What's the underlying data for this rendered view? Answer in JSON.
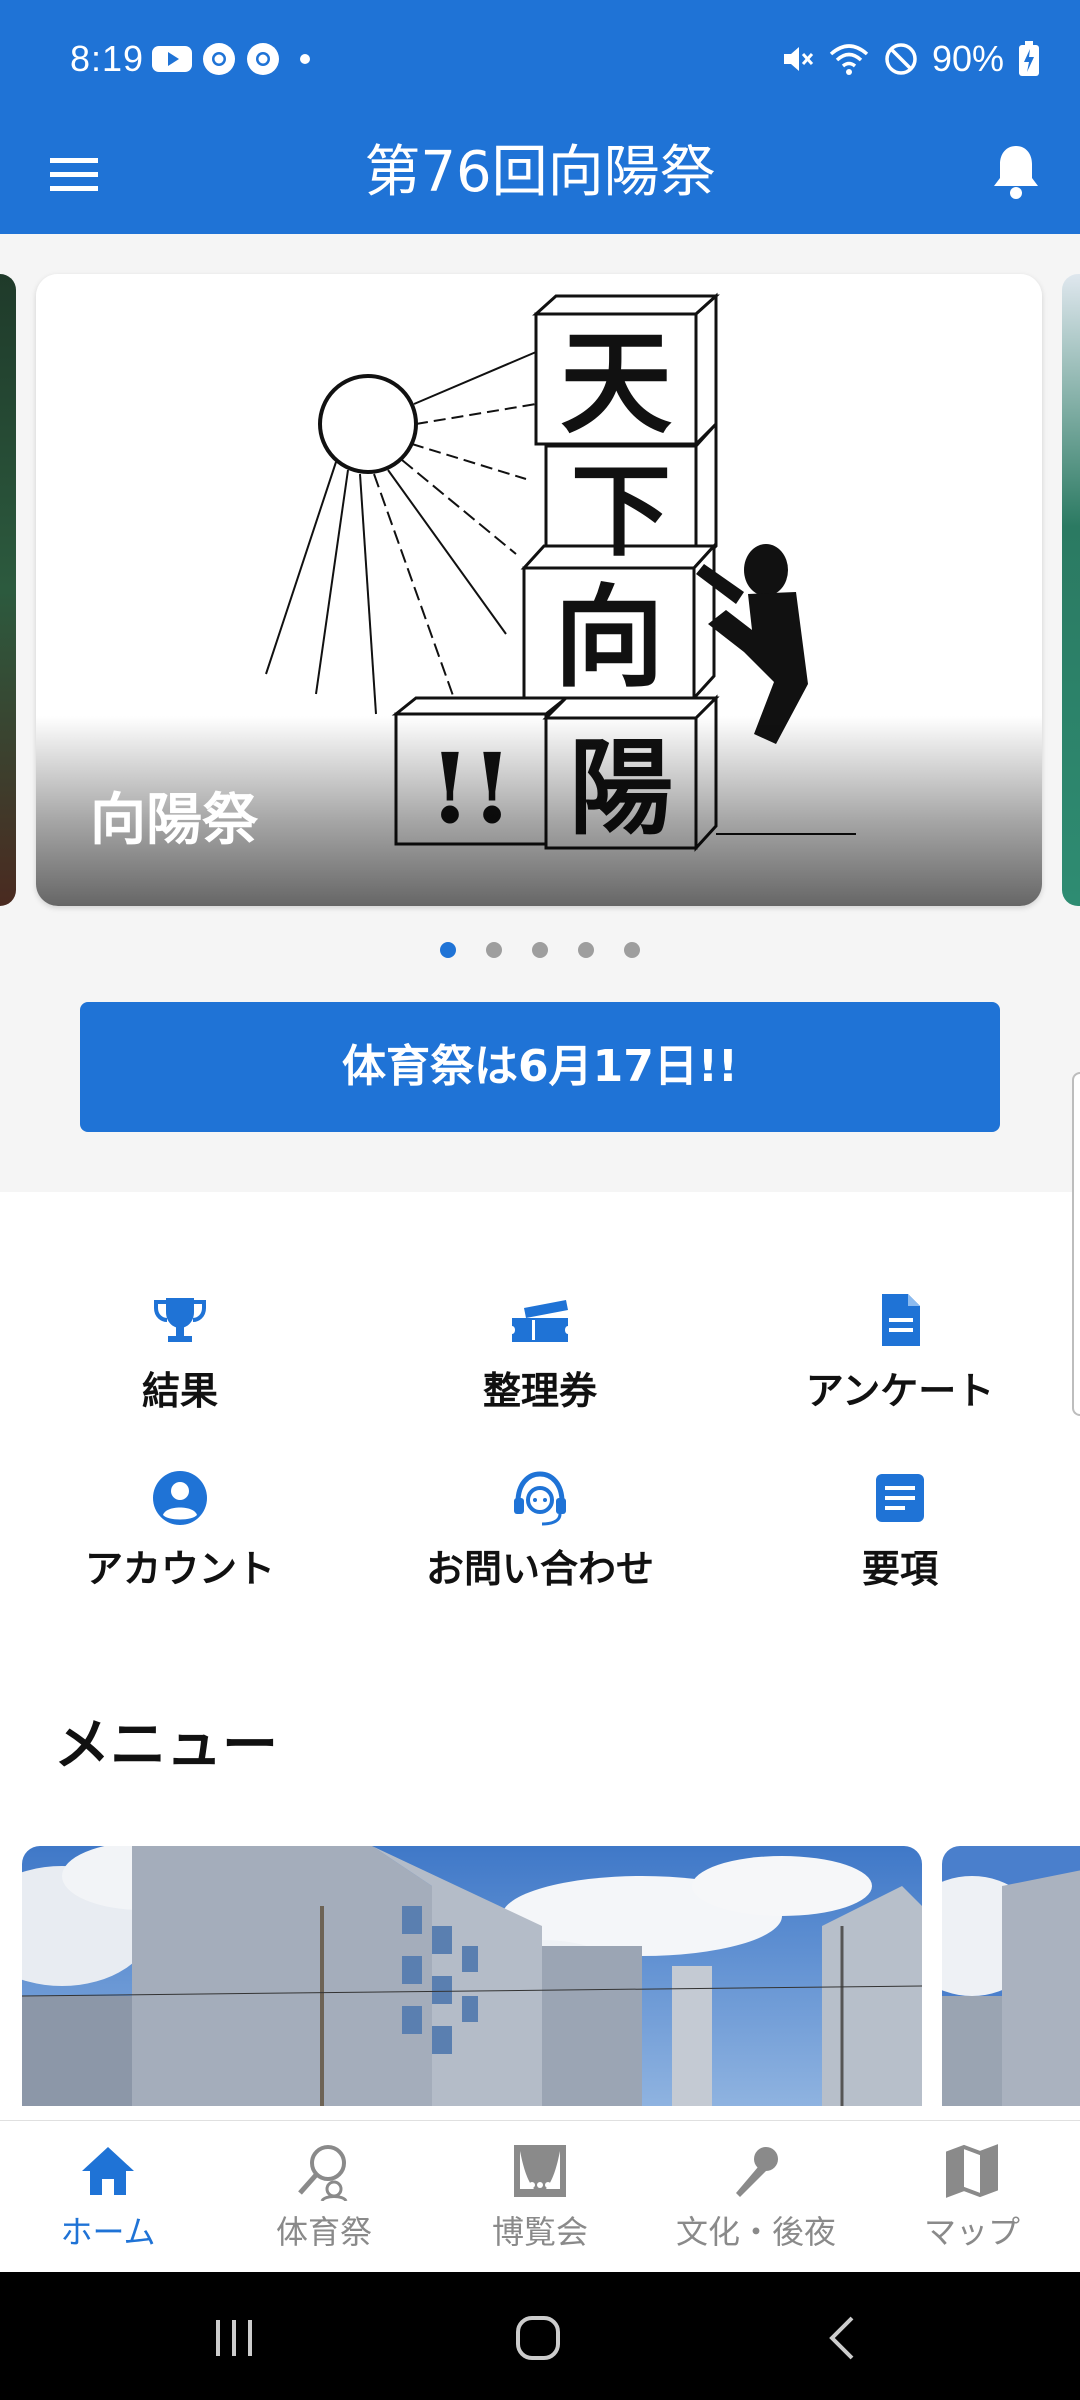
{
  "status_bar": {
    "time": "8:19",
    "battery_percent": "90%",
    "left_icons": [
      "youtube-icon",
      "chrome-icon",
      "chrome-icon",
      "notification-dot-icon"
    ],
    "right_icons": [
      "mute-icon",
      "wifi-icon",
      "do-not-disturb-icon",
      "battery-charging-icon"
    ]
  },
  "app_bar": {
    "title": "第76回向陽祭",
    "left_icon": "hamburger-menu-icon",
    "right_icon": "bell-icon"
  },
  "hero": {
    "caption": "向陽祭",
    "image_text": [
      "天",
      "下",
      "向",
      "陽",
      "!!"
    ],
    "slide_count": 5,
    "active_slide": 1,
    "banner_label": "体育祭は6月17日!!"
  },
  "quick_links": [
    {
      "label": "結果",
      "icon": "trophy-icon"
    },
    {
      "label": "整理券",
      "icon": "ticket-icon"
    },
    {
      "label": "アンケート",
      "icon": "document-icon"
    },
    {
      "label": "アカウント",
      "icon": "account-circle-icon"
    },
    {
      "label": "お問い合わせ",
      "icon": "headset-icon"
    },
    {
      "label": "要項",
      "icon": "list-document-icon"
    }
  ],
  "menu": {
    "heading": "メニュー"
  },
  "bottom_nav": [
    {
      "label": "ホーム",
      "icon": "home-icon",
      "active": true
    },
    {
      "label": "体育祭",
      "icon": "search-person-icon",
      "active": false
    },
    {
      "label": "博覧会",
      "icon": "theater-icon",
      "active": false
    },
    {
      "label": "文化・後夜",
      "icon": "microphone-icon",
      "active": false
    },
    {
      "label": "マップ",
      "icon": "map-icon",
      "active": false
    }
  ],
  "colors": {
    "primary": "#1f73d6",
    "inactive": "#8a8a8a",
    "background": "#f5f5f5"
  }
}
